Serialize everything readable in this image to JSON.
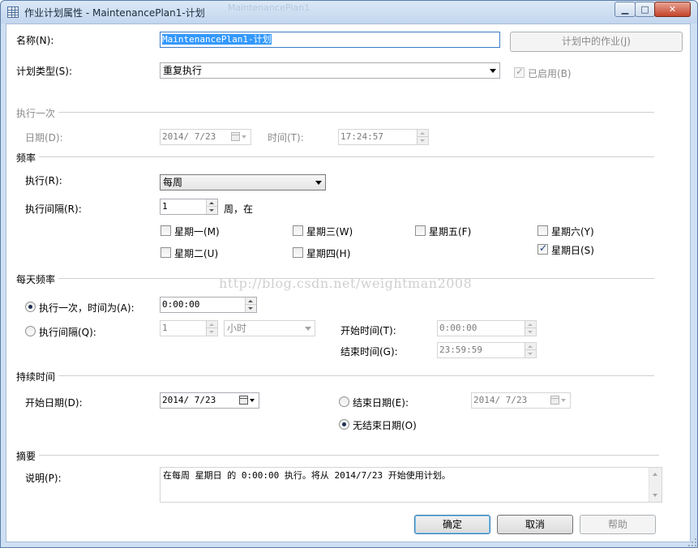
{
  "window": {
    "title": "作业计划属性 - MaintenancePlan1-计划",
    "ghost_title": "MaintenancePlan1",
    "minimize_glyph": "▁",
    "maximize_glyph": "□",
    "close_glyph": "✕"
  },
  "general": {
    "name_label": "名称(N):",
    "name_value": "MaintenancePlan1-计划",
    "jobs_button": "计划中的作业(J)",
    "type_label": "计划类型(S):",
    "type_value": "重复执行",
    "enabled_label": "已启用(B)",
    "enabled_checked": true
  },
  "one_time": {
    "section": "执行一次",
    "date_label": "日期(D):",
    "date_value": "2014/ 7/23",
    "time_label": "时间(T):",
    "time_value": "17:24:57"
  },
  "frequency": {
    "section": "频率",
    "occurs_label": "执行(R):",
    "occurs_value": "每周",
    "recur_label": "执行间隔(R):",
    "recur_value": "1",
    "recur_suffix": "周，在",
    "days": [
      {
        "label": "星期一(M)",
        "checked": false
      },
      {
        "label": "星期三(W)",
        "checked": false
      },
      {
        "label": "星期五(F)",
        "checked": false
      },
      {
        "label": "星期六(Y)",
        "checked": false
      },
      {
        "label": "星期二(U)",
        "checked": false
      },
      {
        "label": "星期四(H)",
        "checked": false
      },
      {
        "label": "星期日(S)",
        "checked": true
      }
    ]
  },
  "daily": {
    "section": "每天频率",
    "once_label": "执行一次，时间为(A):",
    "once_value": "0:00:00",
    "every_label": "执行间隔(Q):",
    "every_value": "1",
    "every_unit": "小时",
    "start_label": "开始时间(T):",
    "start_value": "0:00:00",
    "end_label": "结束时间(G):",
    "end_value": "23:59:59",
    "selected": "once"
  },
  "duration": {
    "section": "持续时间",
    "start_label": "开始日期(D):",
    "start_value": "2014/ 7/23",
    "end_date_label": "结束日期(E):",
    "end_date_value": "2014/ 7/23",
    "no_end_label": "无结束日期(O)",
    "selected": "no_end"
  },
  "summary": {
    "section": "摘要",
    "desc_label": "说明(P):",
    "desc_value": "在每周 星期日 的 0:00:00 执行。将从 2014/7/23 开始使用计划。"
  },
  "buttons": {
    "ok": "确定",
    "cancel": "取消",
    "help": "帮助"
  },
  "watermark": "http://blog.csdn.net/weightman2008"
}
